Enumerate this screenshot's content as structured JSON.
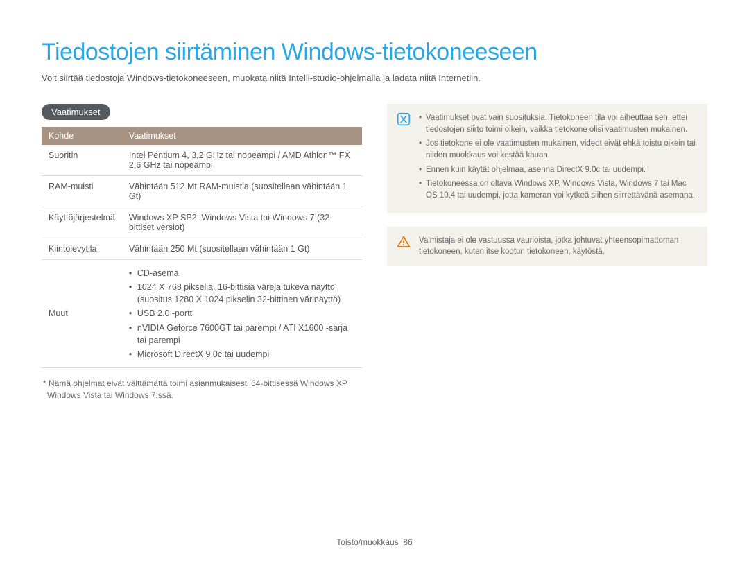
{
  "title": "Tiedostojen siirtäminen Windows-tietokoneeseen",
  "subtitle": "Voit siirtää tiedostoja Windows-tietokoneeseen, muokata niitä Intelli-studio-ohjelmalla ja ladata niitä Internetiin.",
  "pill_label": "Vaatimukset",
  "table": {
    "headers": {
      "col1": "Kohde",
      "col2": "Vaatimukset"
    },
    "rows": {
      "cpu": {
        "label": "Suoritin",
        "value": "Intel Pentium 4, 3,2 GHz tai nopeampi / AMD Athlon™ FX 2,6 GHz tai nopeampi"
      },
      "ram": {
        "label": "RAM-muisti",
        "value": "Vähintään 512 Mt RAM-muistia (suositellaan vähintään 1 Gt)"
      },
      "os": {
        "label": "Käyttöjärjestelmä",
        "value": "Windows XP SP2, Windows Vista tai Windows 7 (32-bittiset versiot)"
      },
      "hdd": {
        "label": "Kiintolevytila",
        "value": "Vähintään 250 Mt (suositellaan vähintään 1 Gt)"
      },
      "other": {
        "label": "Muut",
        "items": [
          "CD-asema",
          "1024 X 768 pikseliä, 16-bittisiä värejä tukeva näyttö (suositus 1280 X 1024 pikselin 32-bittinen värinäyttö)",
          "USB 2.0 -portti",
          "nVIDIA Geforce 7600GT tai parempi / ATI X1600 -sarja tai parempi",
          "Microsoft DirectX 9.0c tai uudempi"
        ]
      }
    }
  },
  "footnote": "* Nämä ohjelmat eivät välttämättä toimi asianmukaisesti 64-bittisessä Windows XP Windows Vista tai Windows 7:ssä.",
  "info_notes": [
    "Vaatimukset ovat vain suosituksia. Tietokoneen tila voi aiheuttaa sen, ettei tiedostojen siirto toimi oikein, vaikka tietokone olisi vaatimusten mukainen.",
    "Jos tietokone ei ole vaatimusten mukainen, videot eivät ehkä toistu oikein tai niiden muokkaus voi kestää kauan.",
    "Ennen kuin käytät ohjelmaa, asenna DirectX 9.0c tai uudempi.",
    "Tietokoneessa on oltava Windows XP, Windows Vista, Windows 7 tai Mac OS 10.4 tai uudempi, jotta kameran voi kytkeä siihen siirrettävänä asemana."
  ],
  "warning_text": "Valmistaja ei ole vastuussa vaurioista, jotka johtuvat yhteensopimattoman tietokoneen, kuten itse kootun tietokoneen, käytöstä.",
  "footer": {
    "section": "Toisto/muokkaus",
    "page": "86"
  }
}
